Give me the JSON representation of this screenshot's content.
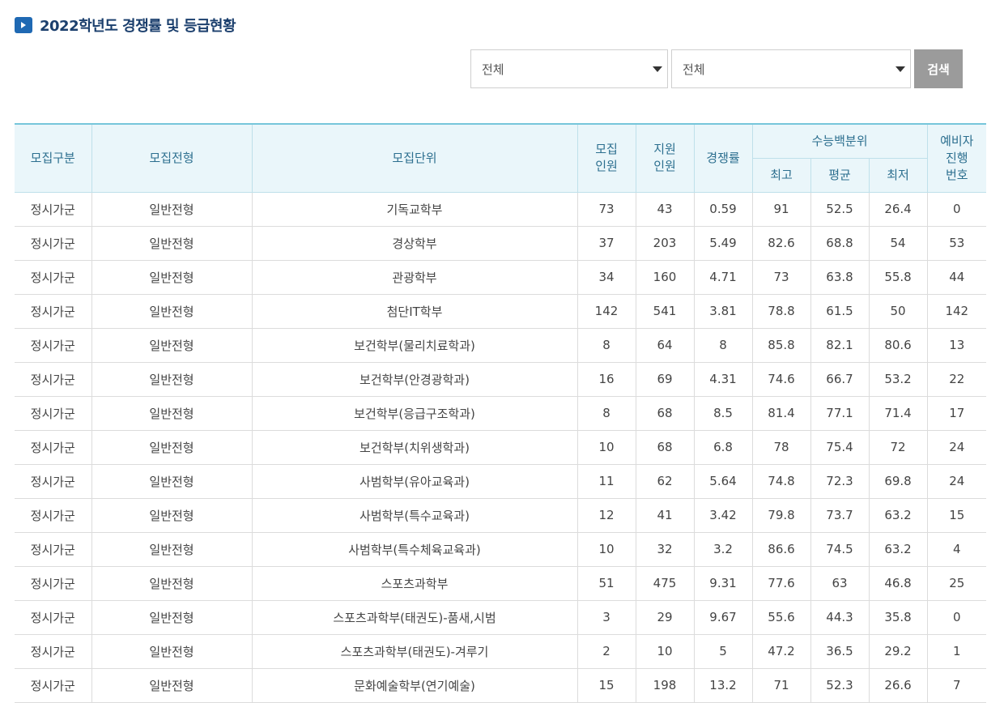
{
  "page": {
    "title": "2022학년도 경쟁률 및 등급현황"
  },
  "filters": {
    "select1": "전체",
    "select2": "전체",
    "search_label": "검색"
  },
  "table": {
    "headers": {
      "col1": "모집구분",
      "col2": "모집전형",
      "col3": "모집단위",
      "col4_l1": "모집",
      "col4_l2": "인원",
      "col5_l1": "지원",
      "col5_l2": "인원",
      "col6": "경쟁률",
      "group": "수능백분위",
      "sub1": "최고",
      "sub2": "평균",
      "sub3": "최저",
      "col10_l1": "예비자",
      "col10_l2": "진행",
      "col10_l3": "번호"
    },
    "rows": [
      [
        "정시가군",
        "일반전형",
        "기독교학부",
        "73",
        "43",
        "0.59",
        "91",
        "52.5",
        "26.4",
        "0"
      ],
      [
        "정시가군",
        "일반전형",
        "경상학부",
        "37",
        "203",
        "5.49",
        "82.6",
        "68.8",
        "54",
        "53"
      ],
      [
        "정시가군",
        "일반전형",
        "관광학부",
        "34",
        "160",
        "4.71",
        "73",
        "63.8",
        "55.8",
        "44"
      ],
      [
        "정시가군",
        "일반전형",
        "첨단IT학부",
        "142",
        "541",
        "3.81",
        "78.8",
        "61.5",
        "50",
        "142"
      ],
      [
        "정시가군",
        "일반전형",
        "보건학부(물리치료학과)",
        "8",
        "64",
        "8",
        "85.8",
        "82.1",
        "80.6",
        "13"
      ],
      [
        "정시가군",
        "일반전형",
        "보건학부(안경광학과)",
        "16",
        "69",
        "4.31",
        "74.6",
        "66.7",
        "53.2",
        "22"
      ],
      [
        "정시가군",
        "일반전형",
        "보건학부(응급구조학과)",
        "8",
        "68",
        "8.5",
        "81.4",
        "77.1",
        "71.4",
        "17"
      ],
      [
        "정시가군",
        "일반전형",
        "보건학부(치위생학과)",
        "10",
        "68",
        "6.8",
        "78",
        "75.4",
        "72",
        "24"
      ],
      [
        "정시가군",
        "일반전형",
        "사범학부(유아교육과)",
        "11",
        "62",
        "5.64",
        "74.8",
        "72.3",
        "69.8",
        "24"
      ],
      [
        "정시가군",
        "일반전형",
        "사범학부(특수교육과)",
        "12",
        "41",
        "3.42",
        "79.8",
        "73.7",
        "63.2",
        "15"
      ],
      [
        "정시가군",
        "일반전형",
        "사범학부(특수체육교육과)",
        "10",
        "32",
        "3.2",
        "86.6",
        "74.5",
        "63.2",
        "4"
      ],
      [
        "정시가군",
        "일반전형",
        "스포츠과학부",
        "51",
        "475",
        "9.31",
        "77.6",
        "63",
        "46.8",
        "25"
      ],
      [
        "정시가군",
        "일반전형",
        "스포츠과학부(태권도)-품새,시범",
        "3",
        "29",
        "9.67",
        "55.6",
        "44.3",
        "35.8",
        "0"
      ],
      [
        "정시가군",
        "일반전형",
        "스포츠과학부(태권도)-겨루기",
        "2",
        "10",
        "5",
        "47.2",
        "36.5",
        "29.2",
        "1"
      ],
      [
        "정시가군",
        "일반전형",
        "문화예술학부(연기예술)",
        "15",
        "198",
        "13.2",
        "71",
        "52.3",
        "26.6",
        "7"
      ]
    ]
  },
  "colors": {
    "title": "#1b3f6d",
    "icon": "#1f69b3",
    "header_bg": "#eaf6fa",
    "header_text": "#2c6f8f",
    "button_bg": "#9b9b9b"
  },
  "icons": {
    "title_icon": "arrow-right-icon",
    "select_arrow": "chevron-down-icon"
  }
}
